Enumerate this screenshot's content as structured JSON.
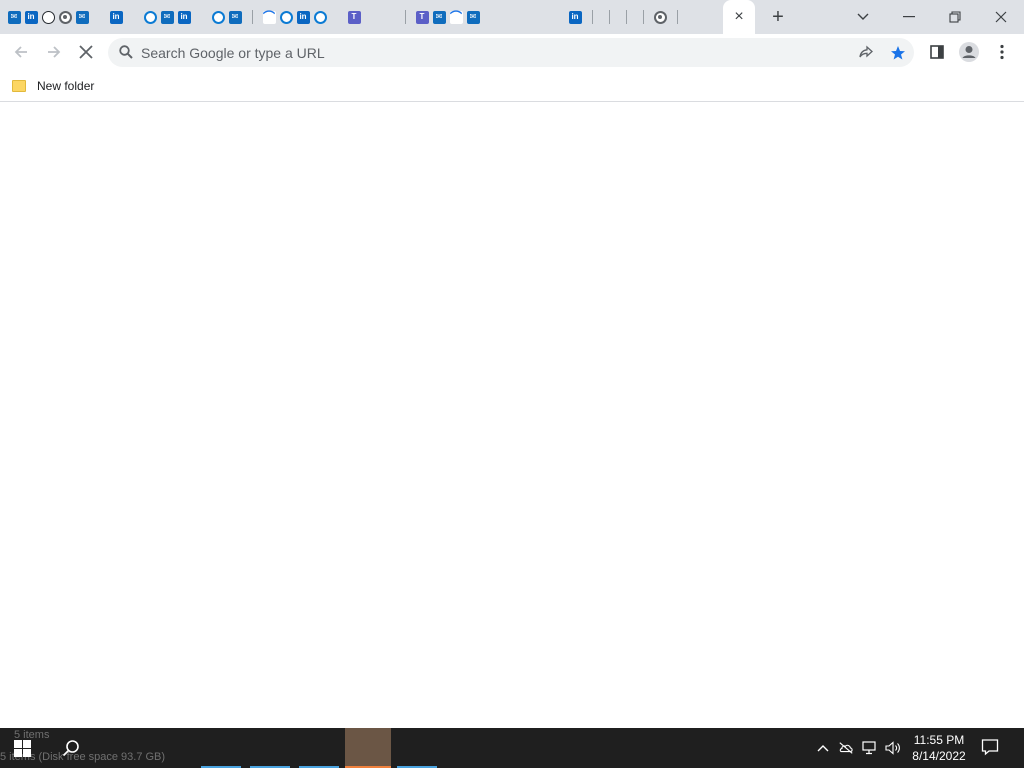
{
  "window": {
    "active_tab_close_label": "×",
    "new_tab_label": "+",
    "controls": {
      "tab_search": "⌄",
      "minimize": "—",
      "restore": "❐",
      "close": "✕"
    }
  },
  "tabs": {
    "favicons": [
      "outlook",
      "linkedin",
      "github",
      "chrome",
      "outlook",
      "microsoft",
      "linkedin",
      "microsoft",
      "edge",
      "outlook",
      "linkedin",
      "microsoft",
      "edge",
      "outlook",
      "blank",
      "swirl",
      "edge",
      "linkedin",
      "edge",
      "microsoft",
      "teams",
      "microsoft",
      "microsoft",
      "blank",
      "teams",
      "outlook",
      "swirl",
      "outlook",
      "microsoft",
      "microsoft",
      "microsoft",
      "microsoft",
      "microsoft",
      "linkedin",
      "blank",
      "blank",
      "blank",
      "blank",
      "chrome",
      "blank"
    ]
  },
  "toolbar": {
    "omnibox_placeholder": "Search Google or type a URL"
  },
  "bookmarks": {
    "items": [
      {
        "label": "New folder",
        "icon": "folder-icon"
      }
    ]
  },
  "taskbar": {
    "ghost_top": "5 items",
    "ghost_bottom": "5 items (Disk free space 93.7 GB)",
    "clock_time": "11:55 PM",
    "clock_date": "8/14/2022",
    "pinned_app_colors": [
      "#4aa3df",
      "#4aa3df",
      "#4aa3df",
      "#f0803c",
      "#4aa3df"
    ]
  },
  "colors": {
    "tabstrip": "#dee1e6",
    "bookmark_star": "#1a73e8",
    "taskbar": "#1f1f1f"
  }
}
